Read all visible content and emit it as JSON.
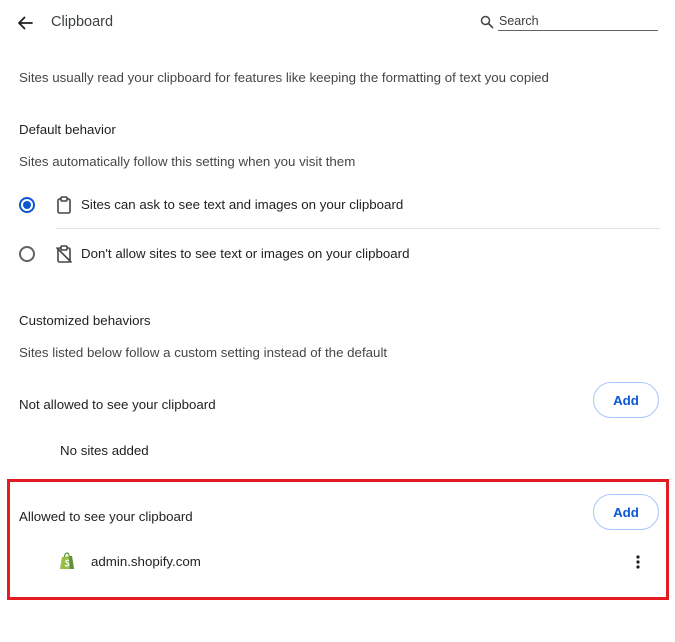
{
  "header": {
    "title": "Clipboard",
    "search_placeholder": "Search",
    "search_value": ""
  },
  "intro": "Sites usually read your clipboard for features like keeping the formatting of text you copied",
  "default_behavior": {
    "heading": "Default behavior",
    "description": "Sites automatically follow this setting when you visit them",
    "options": [
      {
        "label": "Sites can ask to see text and images on your clipboard",
        "icon": "clipboard-icon",
        "selected": true
      },
      {
        "label": "Don't allow sites to see text or images on your clipboard",
        "icon": "clipboard-blocked-icon",
        "selected": false
      }
    ]
  },
  "customized": {
    "heading": "Customized behaviors",
    "description": "Sites listed below follow a custom setting instead of the default",
    "not_allowed": {
      "label": "Not allowed to see your clipboard",
      "add_label": "Add",
      "empty_text": "No sites added"
    },
    "allowed": {
      "label": "Allowed to see your clipboard",
      "add_label": "Add",
      "sites": [
        {
          "name": "admin.shopify.com",
          "favicon": "shopify-bag-icon"
        }
      ]
    }
  },
  "colors": {
    "accent": "#0b57d0",
    "highlight_border": "#e31b23",
    "shopify_green": "#5e8e3e"
  }
}
